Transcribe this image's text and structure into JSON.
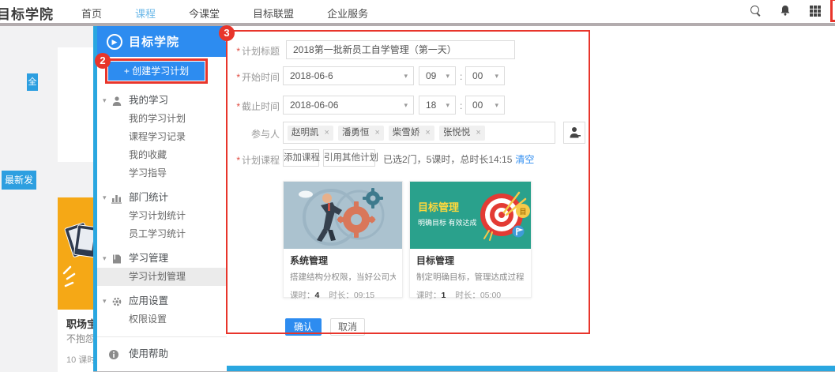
{
  "topbar": {
    "logo": "目标学院",
    "nav": [
      "首页",
      "课程",
      "今课堂",
      "目标联盟",
      "企业服务"
    ],
    "active_nav": "课程"
  },
  "background": {
    "mini_button": "全",
    "badge": "最新发",
    "card_title": "职场宝",
    "card_desc": "不抱怨",
    "card_meta": "10 课时"
  },
  "annotations": {
    "n2": "2",
    "n3": "3"
  },
  "modal": {
    "header": {
      "logo": "目标学院",
      "play_glyph": "▶",
      "nav": [
        "首页",
        "课程",
        "今课堂",
        "目标联盟",
        "企业服务"
      ]
    },
    "sidebar": {
      "create_plus": "+",
      "create_label": "创建学习计划",
      "caret": "▾",
      "groups": [
        {
          "label": "我的学习",
          "items": [
            "我的学习计划",
            "课程学习记录",
            "我的收藏",
            "学习指导"
          ]
        },
        {
          "label": "部门统计",
          "items": [
            "学习计划统计",
            "员工学习统计"
          ]
        },
        {
          "label": "学习管理",
          "items": [
            "学习计划管理"
          ]
        },
        {
          "label": "应用设置",
          "items": [
            "权限设置"
          ]
        }
      ],
      "active_item": "学习计划管理",
      "help": "使用帮助"
    },
    "form": {
      "required_mark": "*",
      "caret": "▾",
      "time_separator": ":",
      "title_label": "计划标题",
      "title_value": "2018第一批新员工自学管理（第一天）",
      "start_label": "开始时间",
      "start_date": "2018-06-6",
      "start_hour": "09",
      "start_minute": "00",
      "end_label": "截止时间",
      "end_date": "2018-06-06",
      "end_hour": "18",
      "end_minute": "00",
      "participants_label": "参与人",
      "members": [
        "赵明凯",
        "潘勇恒",
        "柴雪娇",
        "张悦悦"
      ],
      "courses_label": "计划课程",
      "add_course_button": "添加课程",
      "quote_plan_button": "引用其他计划",
      "selection_summary": "已选2门，5课时，总时长14:15",
      "clear_link": "清空"
    },
    "cards": [
      {
        "title": "系统管理",
        "desc": "搭建结构分权限，当好公司大管家",
        "lessons_label": "课时：",
        "lessons": "4",
        "duration_label": "时长：",
        "duration": "09:15"
      },
      {
        "banner_title": "目标管理",
        "banner_sub": "明确目标 有效达成",
        "title": "目标管理",
        "desc": "制定明确目标，管理达成过程，实...",
        "lessons_label": "课时：",
        "lessons": "1",
        "duration_label": "时长：",
        "duration": "05:00"
      }
    ],
    "actions": {
      "confirm": "确认",
      "cancel": "取消"
    }
  }
}
